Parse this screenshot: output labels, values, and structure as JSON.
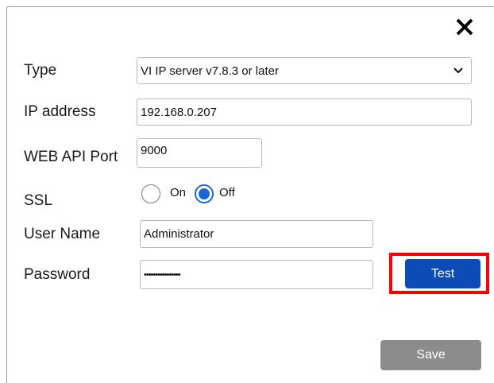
{
  "dialog": {
    "close_icon": "close-icon"
  },
  "form": {
    "type": {
      "label": "Type",
      "value": "VI IP server v7.8.3 or later"
    },
    "ip": {
      "label": "IP address",
      "value": "192.168.0.207"
    },
    "port": {
      "label": "WEB API Port",
      "value": "9000"
    },
    "ssl": {
      "label": "SSL",
      "on_label": "On",
      "off_label": "Off",
      "selected": "Off"
    },
    "username": {
      "label": "User Name",
      "value": "Administrator"
    },
    "password": {
      "label": "Password",
      "value": "••••••••••••••••"
    }
  },
  "buttons": {
    "test": "Test",
    "save": "Save"
  },
  "colors": {
    "primary": "#0d4bb5",
    "radio_selected": "#1a66d6",
    "disabled": "#8c8c8c",
    "highlight": "#ff0000"
  }
}
